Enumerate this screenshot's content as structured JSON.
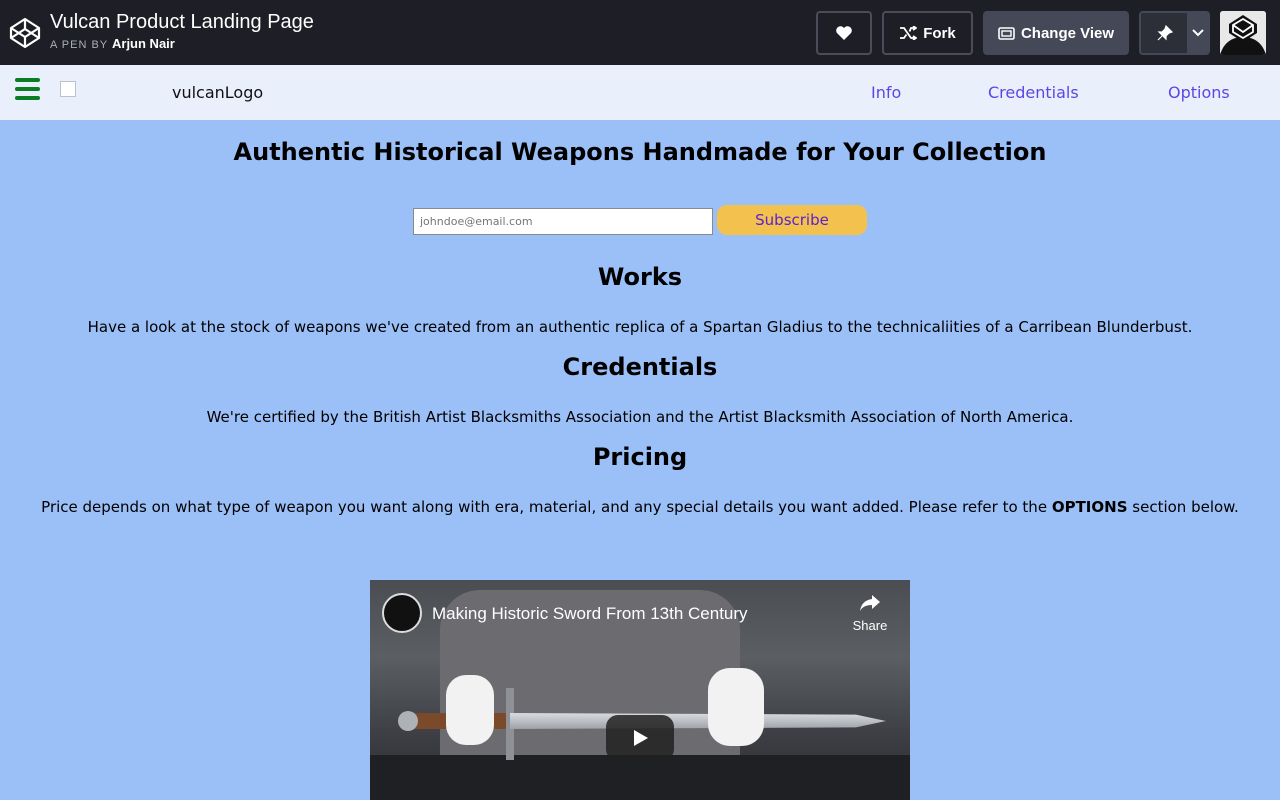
{
  "codepen": {
    "pen_title": "Vulcan Product Landing Page",
    "by_label": "A PEN BY",
    "author": "Arjun Nair",
    "fork_label": "Fork",
    "change_view_label": "Change View",
    "icons": [
      "codepen-logo-icon",
      "heart-icon",
      "fork-icon",
      "change-view-icon",
      "pin-icon",
      "chevron-down-icon"
    ]
  },
  "nav": {
    "logo_alt": "vulcanLogo",
    "links": [
      "Info",
      "Credentials",
      "Options"
    ],
    "link_color": "#5b46e5",
    "menu_color": "#0a7d24"
  },
  "hero": {
    "title": "Authentic Historical Weapons Handmade for Your Collection",
    "email_placeholder": "johndoe@email.com",
    "subscribe_label": "Subscribe"
  },
  "sections": {
    "works": {
      "heading": "Works",
      "text": "Have a look at the stock of weapons we've created from an authentic replica of a Spartan Gladius to the technicaliities of a Carribean Blunderbust."
    },
    "credentials": {
      "heading": "Credentials",
      "text": "We're certified by the British Artist Blacksmiths Association and the Artist Blacksmith Association of North America."
    },
    "pricing": {
      "heading": "Pricing",
      "text_before": "Price depends on what type of weapon you want along with era, material, and any special details you want added. Please refer to the",
      "text_bold": "OPTIONS",
      "text_after": "section below."
    }
  },
  "video": {
    "title": "Making Historic Sword From 13th Century",
    "share_label": "Share"
  },
  "colors": {
    "page_bg": "#9bbff7",
    "header_bg": "#1e1f26",
    "nav_bg": "#e9f0fc",
    "subscribe_bg": "#f2c14e",
    "subscribe_text": "#5b1fd1"
  }
}
